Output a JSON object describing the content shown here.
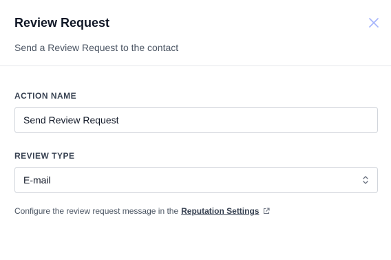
{
  "header": {
    "title": "Review Request",
    "subtitle": "Send a Review Request to the contact",
    "close_icon": "close-icon"
  },
  "form": {
    "action_name": {
      "label": "ACTION NAME",
      "value": "Send Review Request"
    },
    "review_type": {
      "label": "REVIEW TYPE",
      "selected": "E-mail",
      "icon": "select-arrows-icon"
    }
  },
  "hint": {
    "text": "Configure the review request message in the",
    "link_text": "Reputation Settings",
    "link_icon": "external-link-icon"
  },
  "colors": {
    "border": "#d1d5db",
    "divider": "#e5e7eb",
    "close": "#a5b4fc"
  }
}
